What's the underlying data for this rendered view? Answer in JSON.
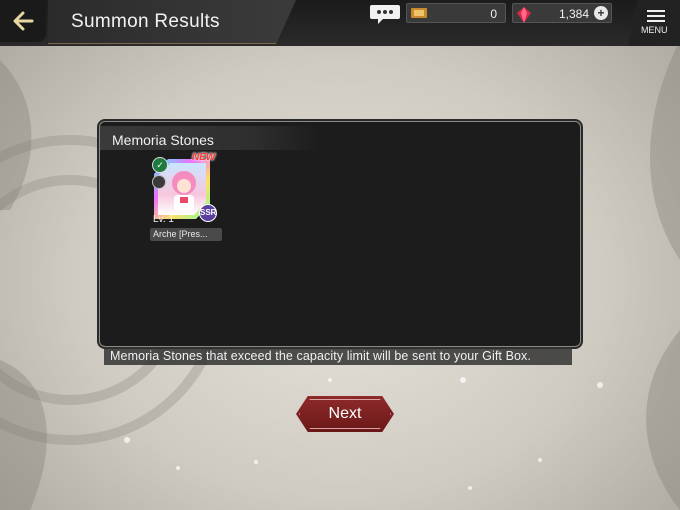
{
  "header": {
    "title": "Summon Results",
    "back_icon": "back-arrow-icon",
    "chat_icon": "chat-bubble-icon",
    "menu_label": "MENU"
  },
  "currencies": {
    "tickets": {
      "icon": "ticket-icon",
      "value": "0"
    },
    "gems": {
      "icon": "gem-icon",
      "value": "1,384",
      "plus": "+"
    }
  },
  "panel": {
    "title": "Memoria Stones",
    "cards": [
      {
        "badge": "NEW",
        "level": "Lv. 1",
        "name": "Arche [Pres...",
        "rarity": "SSR",
        "type_icon": "leaf-icon"
      }
    ],
    "notice": "Memoria Stones that exceed the capacity limit will be sent to your Gift Box."
  },
  "actions": {
    "next_label": "Next"
  },
  "colors": {
    "accent_red": "#8e2a2a",
    "panel_bg": "#1c1c1c",
    "topbar_bg": "#1b1b1b"
  }
}
